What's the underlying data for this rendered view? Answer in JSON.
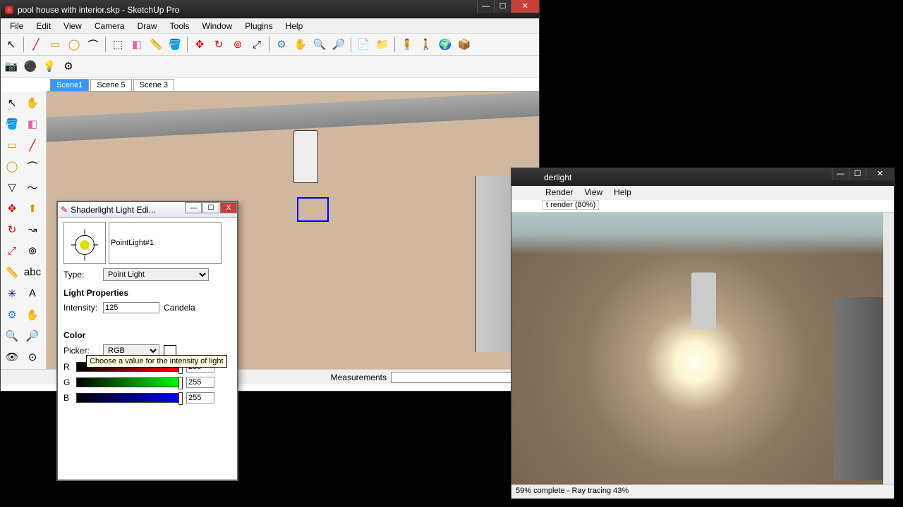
{
  "main_window": {
    "title": "pool house with interior.skp - SketchUp Pro",
    "menu": [
      "File",
      "Edit",
      "View",
      "Camera",
      "Draw",
      "Tools",
      "Window",
      "Plugins",
      "Help"
    ],
    "tabs": [
      "Scene1",
      "Scene 5",
      "Scene 3"
    ],
    "active_tab": 0,
    "measurements_label": "Measurements"
  },
  "light_editor": {
    "title": "Shaderlight Light Edi...",
    "name": "PointLight#1",
    "type_label": "Type:",
    "type_value": "Point Light",
    "section_props": "Light Properties",
    "intensity_label": "Intensity:",
    "intensity_value": "125",
    "intensity_unit": "Candela",
    "intensity_tooltip": "Choose a value for the intensity of light",
    "section_color": "Color",
    "picker_label": "Picker:",
    "picker_value": "RGB",
    "r_label": "R",
    "g_label": "G",
    "b_label": "B",
    "r_value": "255",
    "g_value": "255",
    "b_value": "255"
  },
  "render_window": {
    "title_fragment": "derlight",
    "menu": [
      "Render",
      "View",
      "Help"
    ],
    "tab_fragment": "t render (80%)",
    "status": "59% complete - Ray tracing 43%"
  }
}
